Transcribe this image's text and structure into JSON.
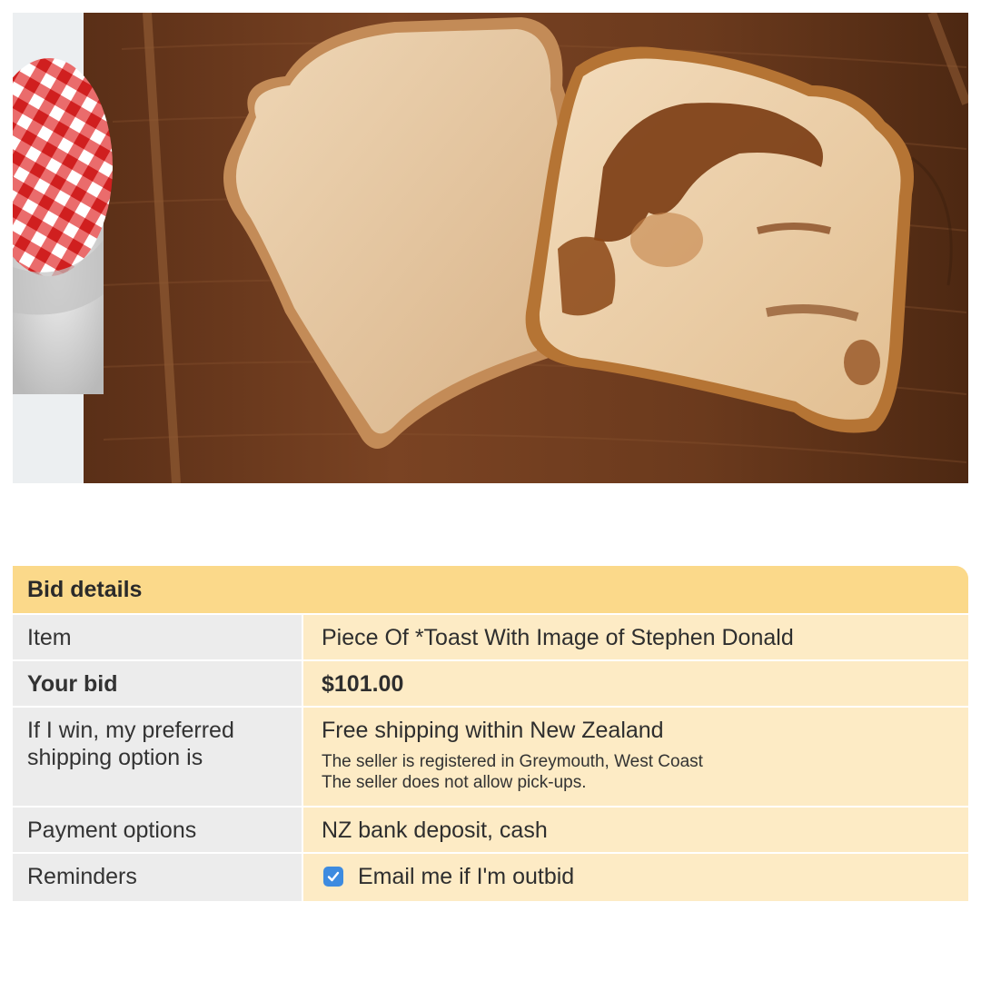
{
  "photo": {
    "alt": "Toast with face",
    "colors": {
      "board": "#6f3c1e",
      "bread": "#e9c9a0",
      "crust": "#b97a3e",
      "toast_dark": "#6a3410"
    }
  },
  "bid_details": {
    "title": "Bid details",
    "item_label": "Item",
    "item_value": "Piece Of *Toast With Image of Stephen Donald",
    "your_bid_label": "Your bid",
    "your_bid_value": "$101.00",
    "shipping_label": "If I win, my preferred\nshipping option is",
    "shipping_value": "Free shipping within New Zealand",
    "seller_location": "The seller is registered in Greymouth, West Coast",
    "seller_pickup": "The seller does not allow pick-ups.",
    "payment_label": "Payment options",
    "payment_value": "NZ bank deposit, cash",
    "reminders_label": "Reminders",
    "reminder_option": "Email me if I'm outbid",
    "reminder_checked": true
  },
  "colors": {
    "header_bg": "#fbd98a",
    "label_bg": "#ececec",
    "value_bg": "#fdebc5",
    "checkbox": "#3d8be0"
  }
}
